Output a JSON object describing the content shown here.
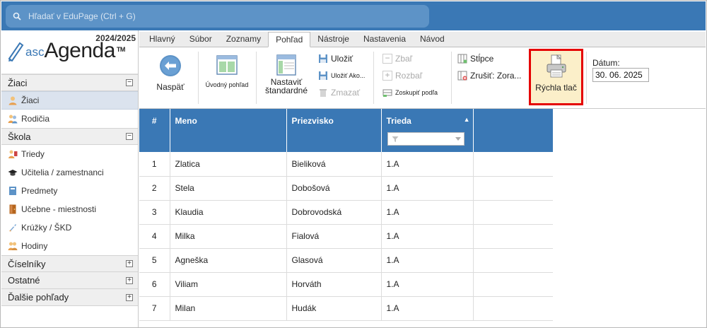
{
  "search": {
    "placeholder": "Hľadať v EduPage (Ctrl + G)"
  },
  "app": {
    "year": "2024/2025",
    "logo_prefix": "asc",
    "logo_name": "Agenda",
    "logo_tm": "TM"
  },
  "sidebar": {
    "sections": [
      {
        "title": "Žiaci",
        "toggle": "−",
        "items": [
          "Žiaci",
          "Rodičia"
        ]
      },
      {
        "title": "Škola",
        "toggle": "−",
        "items": [
          "Triedy",
          "Učitelia / zamestnanci",
          "Predmety",
          "Učebne - miestnosti",
          "Krúžky / ŠKD",
          "Hodiny"
        ]
      },
      {
        "title": "Číselníky",
        "toggle": "+"
      },
      {
        "title": "Ostatné",
        "toggle": "+"
      },
      {
        "title": "Ďalšie pohľady",
        "toggle": "+"
      }
    ]
  },
  "ribbon": {
    "tabs": [
      "Hlavný",
      "Súbor",
      "Zoznamy",
      "Pohľad",
      "Nástroje",
      "Nastavenia",
      "Návod"
    ],
    "active_tab": "Pohľad",
    "back": "Naspäť",
    "home_view": "Úvodný pohľad",
    "set_default_1": "Nastaviť",
    "set_default_2": "štandardné",
    "save": "Uložiť",
    "save_as": "Uložiť Ako...",
    "delete": "Zmazať",
    "collapse": "Zbaľ",
    "expand": "Rozbaľ",
    "group_by": "Zoskupiť podľa",
    "columns": "Stĺpce",
    "cancel_sort": "Zrušiť: Zora...",
    "quick_print": "Rýchla tlač",
    "date_label": "Dátum:",
    "date_value": "30. 06. 2025"
  },
  "colors": {
    "header_blue": "#3a78b5",
    "highlight_red": "#e50000",
    "quick_print_bg": "#fbefc9"
  },
  "table": {
    "columns": [
      "#",
      "Meno",
      "Priezvisko",
      "Trieda"
    ],
    "sort_indicator": "▲",
    "rows": [
      [
        "1",
        "Zlatica",
        "Bieliková",
        "1.A"
      ],
      [
        "2",
        "Stela",
        "Dobošová",
        "1.A"
      ],
      [
        "3",
        "Klaudia",
        "Dobrovodská",
        "1.A"
      ],
      [
        "4",
        "Milka",
        "Fialová",
        "1.A"
      ],
      [
        "5",
        "Agneška",
        "Glasová",
        "1.A"
      ],
      [
        "6",
        "Viliam",
        "Horváth",
        "1.A"
      ],
      [
        "7",
        "Milan",
        "Hudák",
        "1.A"
      ]
    ]
  }
}
